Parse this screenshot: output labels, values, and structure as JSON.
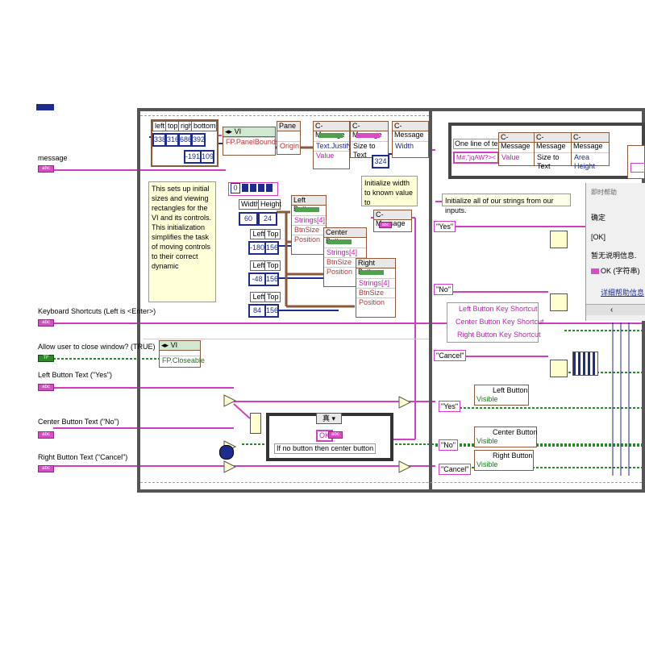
{
  "front_controls": {
    "message": "message",
    "keyboard": "Keyboard Shortcuts (Left is <Enter>)",
    "allow_close": "Allow user to close window? (TRUE)",
    "left_text": "Left Button Text (\"Yes\")",
    "center_text": "Center Button Text (\"No\")",
    "right_text": "Right Button Text (\"Cancel\")",
    "abc": "abc",
    "tf": "TF"
  },
  "bounds": {
    "headers": [
      "left",
      "top",
      "right",
      "bottom"
    ],
    "values": [
      "338",
      "316",
      "686",
      "392"
    ],
    "extra": [
      "-191",
      "109"
    ]
  },
  "vi_node": {
    "title": "VI",
    "prop1": "FP.PanelBounds",
    "pane": "Pane",
    "origin": "Origin",
    "closeable": "FP.Closeable"
  },
  "cmessage": {
    "title": "C-Message",
    "justify": "Text.Justify",
    "size_to_text": "Size to Text",
    "width": "Width",
    "value": "Value",
    "width_value": "324",
    "area_height": "Area Height"
  },
  "comment1": "This sets up initial sizes and viewing rectangles for the VI and its controls. This initialization simplifies the task of moving controls to their correct dynamic",
  "comment2": "Initialize width to known value to",
  "comment3": "Initialize all of our strings from our inputs.",
  "sizes": {
    "zero": "0",
    "wh": [
      "Width",
      "Height"
    ],
    "wh_vals": [
      "60",
      "24"
    ],
    "lt": [
      "Left",
      "Top"
    ],
    "lt1": [
      "-180",
      "156"
    ],
    "lt2": [
      "-48",
      "156"
    ],
    "lt3": [
      "84",
      "156"
    ]
  },
  "buttons": {
    "left": "Left Button",
    "center": "Center Button",
    "right": "Right Button",
    "strings4": "Strings[4]",
    "btnsize": "BtnSize",
    "position": "Position",
    "visible": "Visible"
  },
  "right_panel": {
    "one_line": "One line of text",
    "sample": "M#,\"jqAW?><",
    "yes": "\"Yes\"",
    "no": "\"No\"",
    "cancel": "\"Cancel\"",
    "shortcuts": [
      "Left Button Key Shortcut",
      "Center Button Key Shortcut",
      "Right Button Key Shortcut"
    ]
  },
  "case_struct": {
    "selector": "真",
    "ok": "OK",
    "note": "If no button then center button"
  },
  "help_window": {
    "title": "即时帮助",
    "line1": "确定",
    "line2": "[OK]",
    "line3": "暂无说明信息.",
    "line4": "OK (字符串)",
    "link": "详细帮助信息"
  },
  "colors": {
    "string_wire": "#d040c0",
    "numeric_wire": "#1e2b8f",
    "bool_wire": "#2a8a2a",
    "ref_wire": "#8a5a3a"
  }
}
